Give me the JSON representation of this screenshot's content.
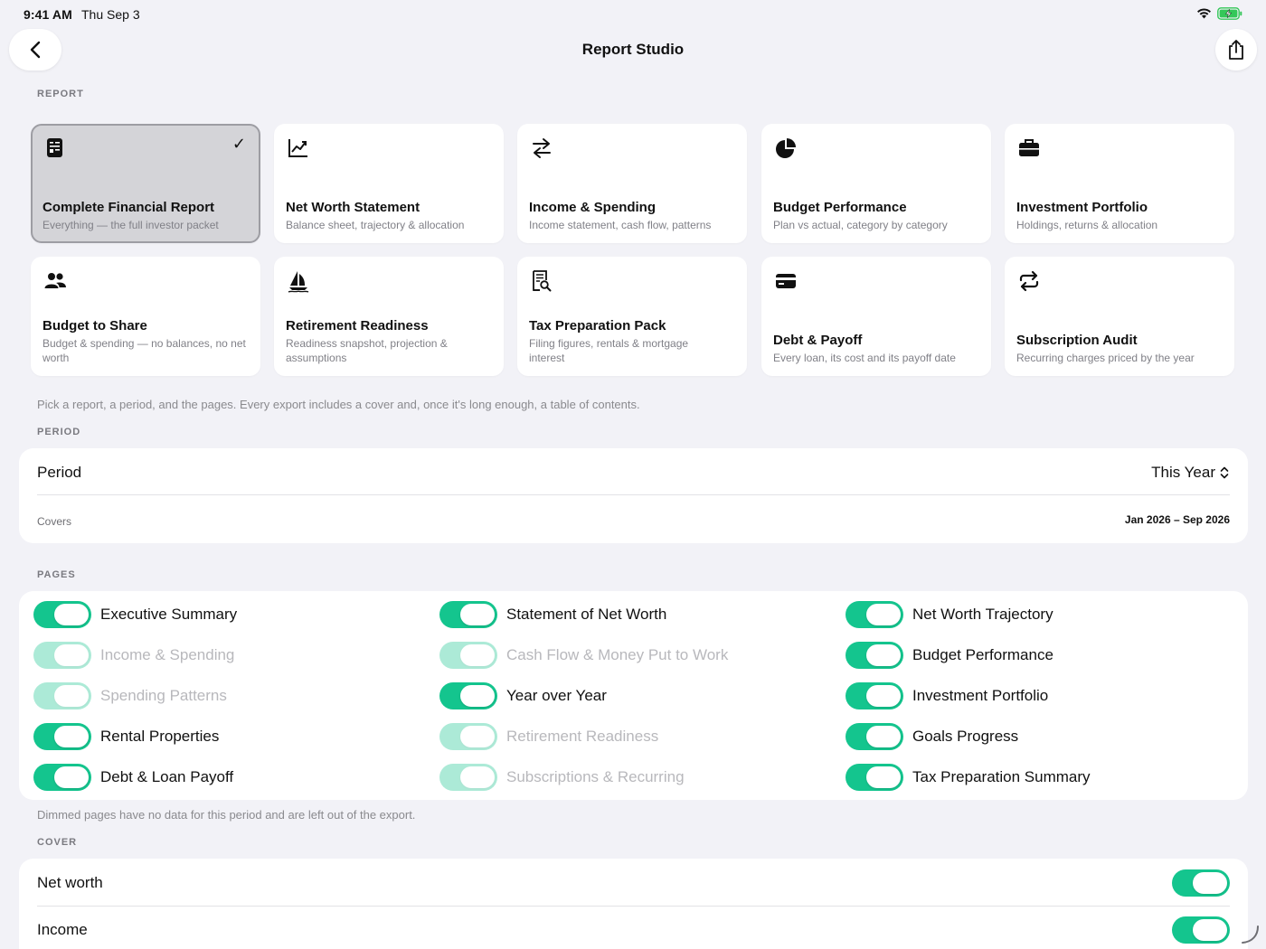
{
  "status": {
    "time": "9:41 AM",
    "date": "Thu Sep 3"
  },
  "nav": {
    "title": "Report Studio"
  },
  "report_section": {
    "header": "REPORT",
    "cards": [
      {
        "title": "Complete Financial Report",
        "subtitle": "Everything — the full investor packet",
        "icon": "report-doc-icon",
        "selected": true
      },
      {
        "title": "Net Worth Statement",
        "subtitle": "Balance sheet, trajectory & allocation",
        "icon": "line-chart-icon",
        "selected": false
      },
      {
        "title": "Income & Spending",
        "subtitle": "Income statement, cash flow, patterns",
        "icon": "arrows-swap-icon",
        "selected": false
      },
      {
        "title": "Budget Performance",
        "subtitle": "Plan vs actual, category by category",
        "icon": "pie-chart-icon",
        "selected": false
      },
      {
        "title": "Investment Portfolio",
        "subtitle": "Holdings, returns & allocation",
        "icon": "briefcase-icon",
        "selected": false
      },
      {
        "title": "Budget to Share",
        "subtitle": "Budget & spending — no balances, no net worth",
        "icon": "people-icon",
        "selected": false
      },
      {
        "title": "Retirement Readiness",
        "subtitle": "Readiness snapshot, projection & assumptions",
        "icon": "sailboat-icon",
        "selected": false
      },
      {
        "title": "Tax Preparation Pack",
        "subtitle": "Filing figures, rentals & mortgage interest",
        "icon": "receipt-search-icon",
        "selected": false
      },
      {
        "title": "Debt & Payoff",
        "subtitle": "Every loan, its cost and its payoff date",
        "icon": "credit-card-icon",
        "selected": false
      },
      {
        "title": "Subscription Audit",
        "subtitle": "Recurring charges priced by the year",
        "icon": "repeat-icon",
        "selected": false
      }
    ],
    "note": "Pick a report, a period, and the pages. Every export includes a cover and, once it's long enough, a table of contents."
  },
  "period_section": {
    "header": "PERIOD",
    "label": "Period",
    "value": "This Year",
    "covers_label": "Covers",
    "covers_value": "Jan 2026 – Sep 2026"
  },
  "pages_section": {
    "header": "PAGES",
    "columns": [
      [
        {
          "label": "Executive Summary",
          "on": true,
          "dimmed": false
        },
        {
          "label": "Income & Spending",
          "on": true,
          "dimmed": true
        },
        {
          "label": "Spending Patterns",
          "on": true,
          "dimmed": true
        },
        {
          "label": "Rental Properties",
          "on": true,
          "dimmed": false
        },
        {
          "label": "Debt & Loan Payoff",
          "on": true,
          "dimmed": false
        }
      ],
      [
        {
          "label": "Statement of Net Worth",
          "on": true,
          "dimmed": false
        },
        {
          "label": "Cash Flow & Money Put to Work",
          "on": true,
          "dimmed": true
        },
        {
          "label": "Year over Year",
          "on": true,
          "dimmed": false
        },
        {
          "label": "Retirement Readiness",
          "on": true,
          "dimmed": true
        },
        {
          "label": "Subscriptions & Recurring",
          "on": true,
          "dimmed": true
        }
      ],
      [
        {
          "label": "Net Worth Trajectory",
          "on": true,
          "dimmed": false
        },
        {
          "label": "Budget Performance",
          "on": true,
          "dimmed": false
        },
        {
          "label": "Investment Portfolio",
          "on": true,
          "dimmed": false
        },
        {
          "label": "Goals Progress",
          "on": true,
          "dimmed": false
        },
        {
          "label": "Tax Preparation Summary",
          "on": true,
          "dimmed": false
        }
      ]
    ],
    "note": "Dimmed pages have no data for this period and are left out of the export."
  },
  "cover_section": {
    "header": "COVER",
    "rows": [
      {
        "label": "Net worth",
        "on": true
      },
      {
        "label": "Income",
        "on": true
      }
    ]
  },
  "colors": {
    "accent": "#14c58e",
    "background": "#f2f2f7",
    "selected_card": "#d4d4d8"
  }
}
